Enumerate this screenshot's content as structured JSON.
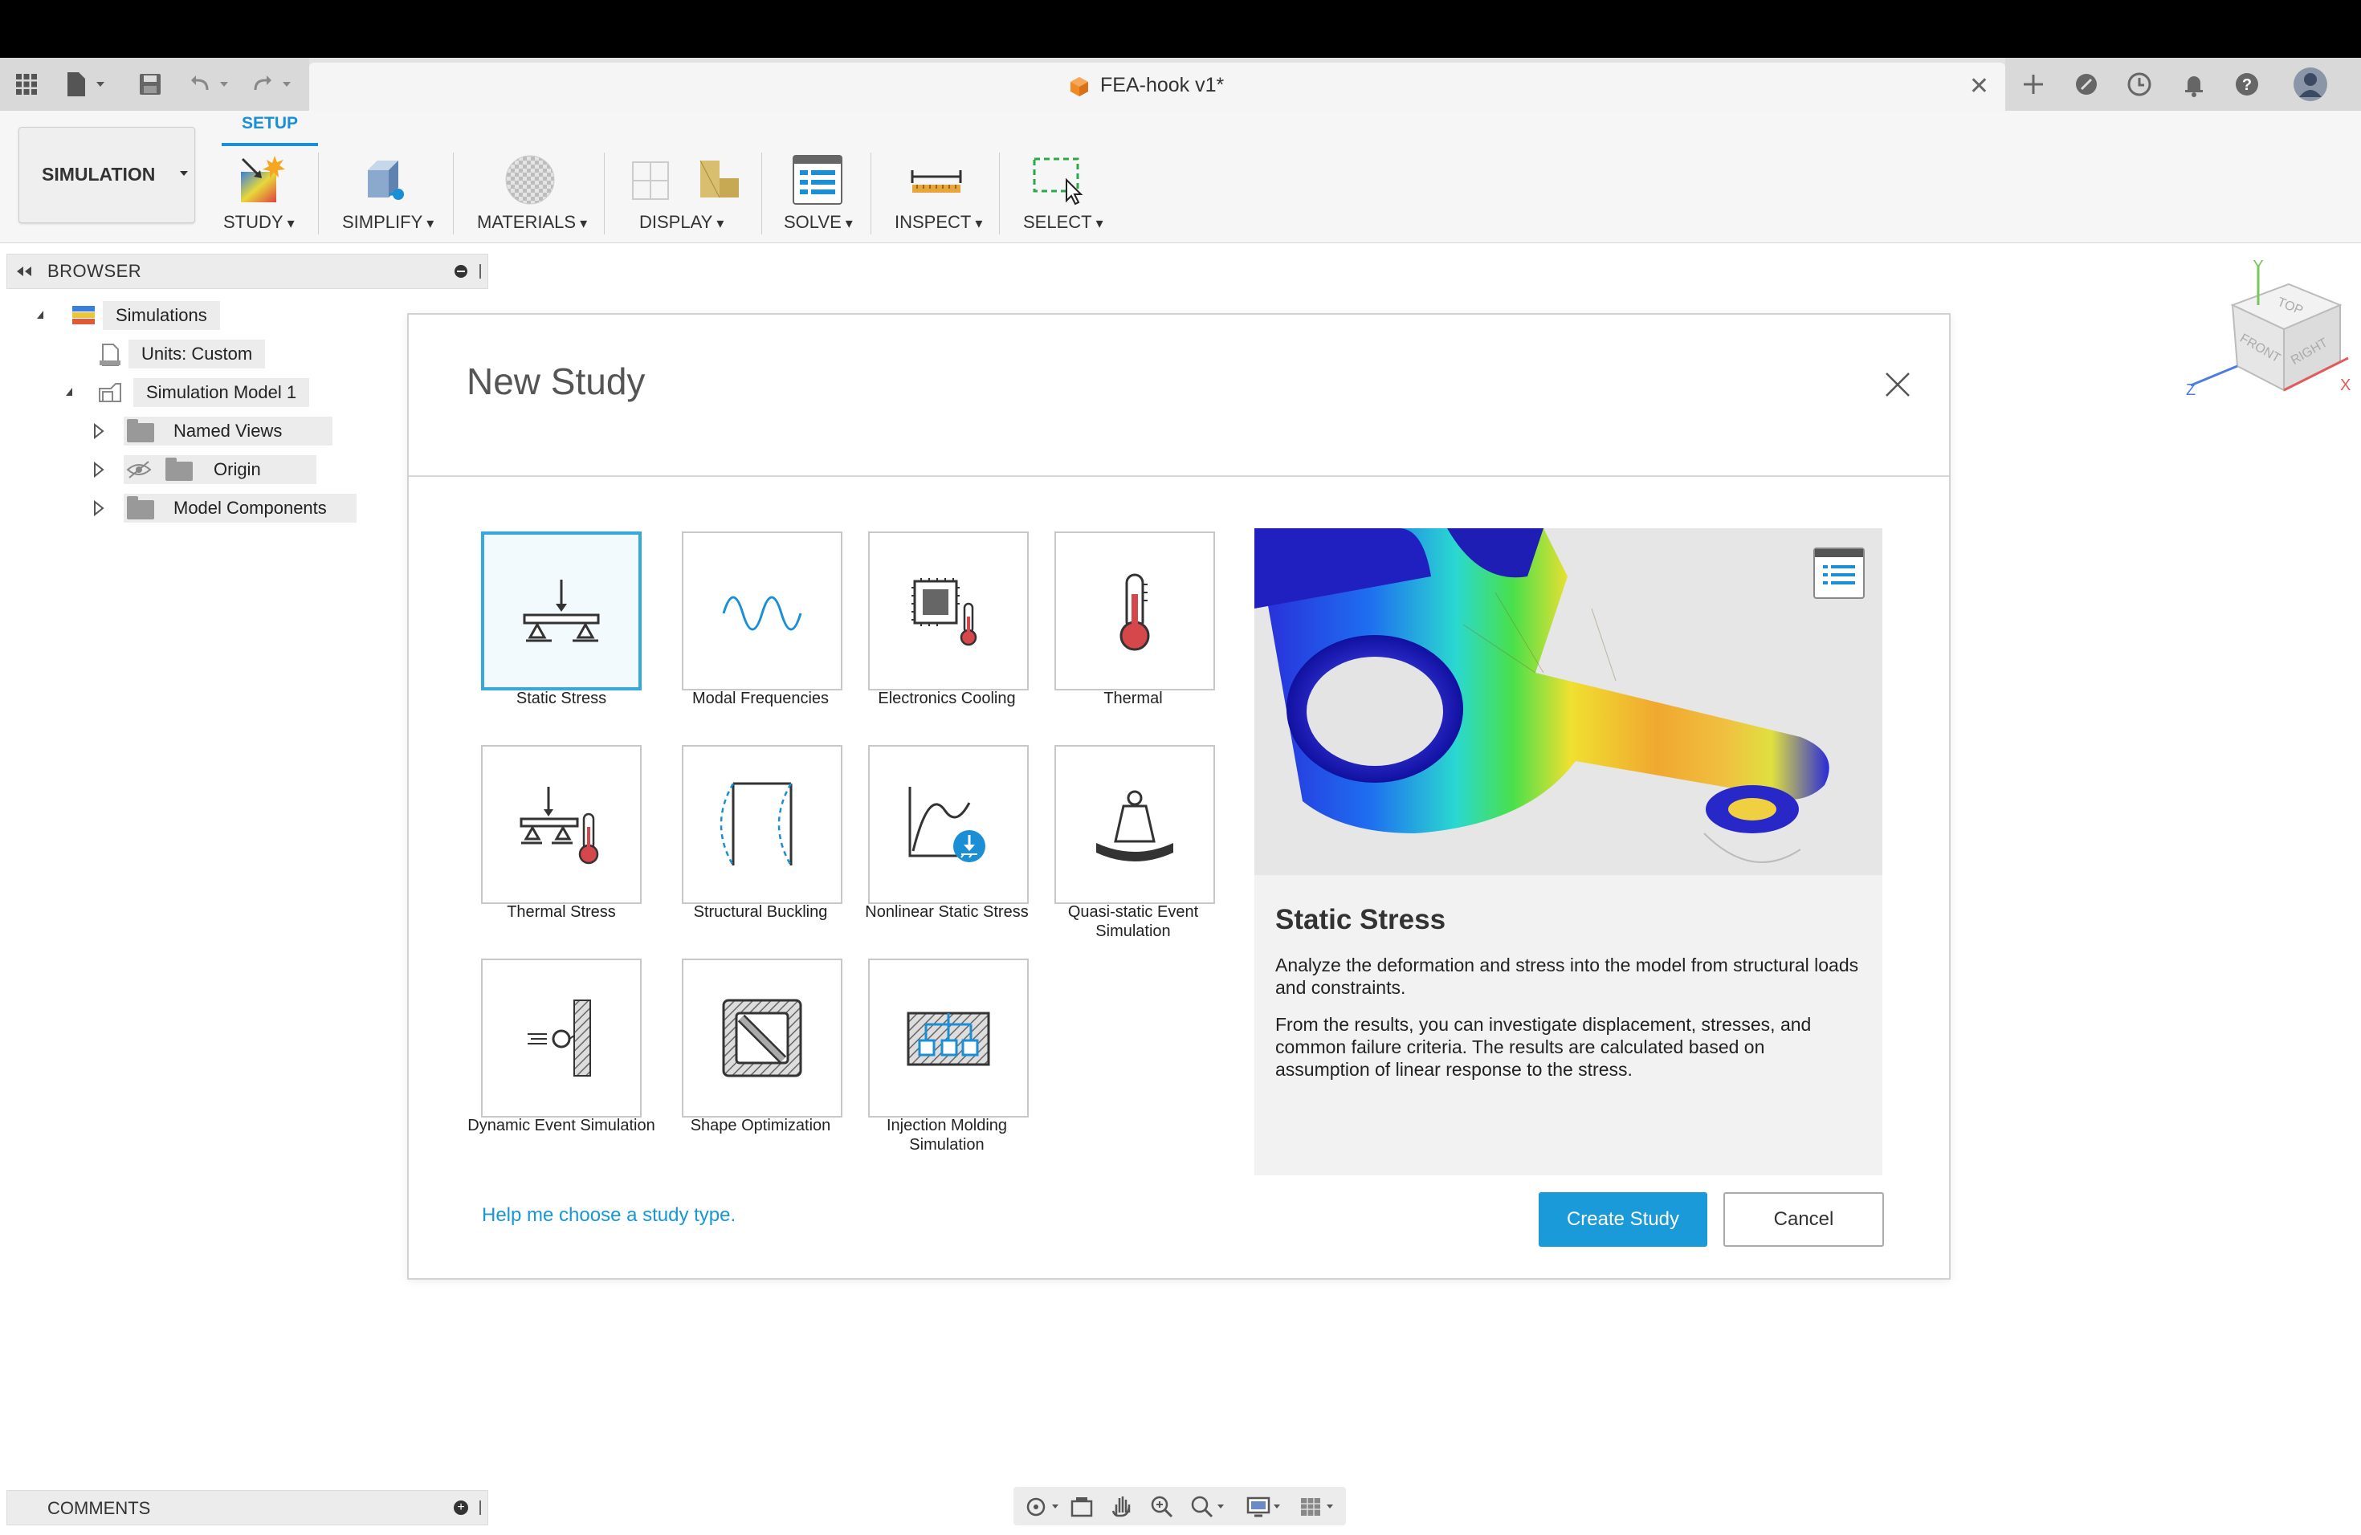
{
  "app": {
    "document_title": "FEA-hook v1*",
    "accent_color": "#1a9ad8"
  },
  "toolbar": {
    "workspace_label": "SIMULATION",
    "active_tab": "SETUP",
    "groups": [
      {
        "label": "STUDY",
        "icon": "study-icon"
      },
      {
        "label": "SIMPLIFY",
        "icon": "simplify-icon"
      },
      {
        "label": "MATERIALS",
        "icon": "materials-icon"
      },
      {
        "label": "DISPLAY",
        "icon": "display-icon"
      },
      {
        "label": "SOLVE",
        "icon": "solve-icon"
      },
      {
        "label": "INSPECT",
        "icon": "inspect-icon"
      },
      {
        "label": "SELECT",
        "icon": "select-icon"
      }
    ]
  },
  "browser": {
    "title": "BROWSER",
    "items": [
      {
        "label": "Simulations",
        "icon": "simulations-icon",
        "expanded": true
      },
      {
        "label": "Units: Custom",
        "icon": "document-icon"
      },
      {
        "label": "Simulation Model 1",
        "icon": "model-icon",
        "expanded": true
      },
      {
        "label": "Named Views",
        "icon": "folder-icon",
        "expanded": false
      },
      {
        "label": "Origin",
        "icon": "folder-icon",
        "expanded": false,
        "hidden": true
      },
      {
        "label": "Model Components",
        "icon": "folder-icon",
        "expanded": false
      }
    ]
  },
  "comments": {
    "title": "COMMENTS"
  },
  "viewcube": {
    "top": "TOP",
    "front": "FRONT",
    "right": "RIGHT",
    "x": "X",
    "y": "Y",
    "z": "Z"
  },
  "dialog": {
    "title": "New Study",
    "study_types": [
      {
        "label": "Static Stress",
        "icon": "static-stress-icon",
        "selected": true
      },
      {
        "label": "Modal Frequencies",
        "icon": "modal-frequencies-icon"
      },
      {
        "label": "Electronics Cooling",
        "icon": "electronics-cooling-icon"
      },
      {
        "label": "Thermal",
        "icon": "thermal-icon"
      },
      {
        "label": "Thermal Stress",
        "icon": "thermal-stress-icon"
      },
      {
        "label": "Structural Buckling",
        "icon": "structural-buckling-icon"
      },
      {
        "label": "Nonlinear Static Stress",
        "icon": "nonlinear-static-stress-icon"
      },
      {
        "label": "Quasi-static Event Simulation",
        "icon": "quasi-static-event-icon"
      },
      {
        "label": "Dynamic Event Simulation",
        "icon": "dynamic-event-icon"
      },
      {
        "label": "Shape Optimization",
        "icon": "shape-optimization-icon"
      },
      {
        "label": "Injection Molding Simulation",
        "icon": "injection-molding-icon"
      }
    ],
    "preview": {
      "title": "Static Stress",
      "description_1": "Analyze the deformation and stress into the model from structural loads and constraints.",
      "description_2": "From the results, you can investigate displacement, stresses, and common failure criteria. The results are calculated based on assumption of linear response to the stress."
    },
    "help_link": "Help me choose a study type.",
    "create_label": "Create Study",
    "cancel_label": "Cancel"
  }
}
